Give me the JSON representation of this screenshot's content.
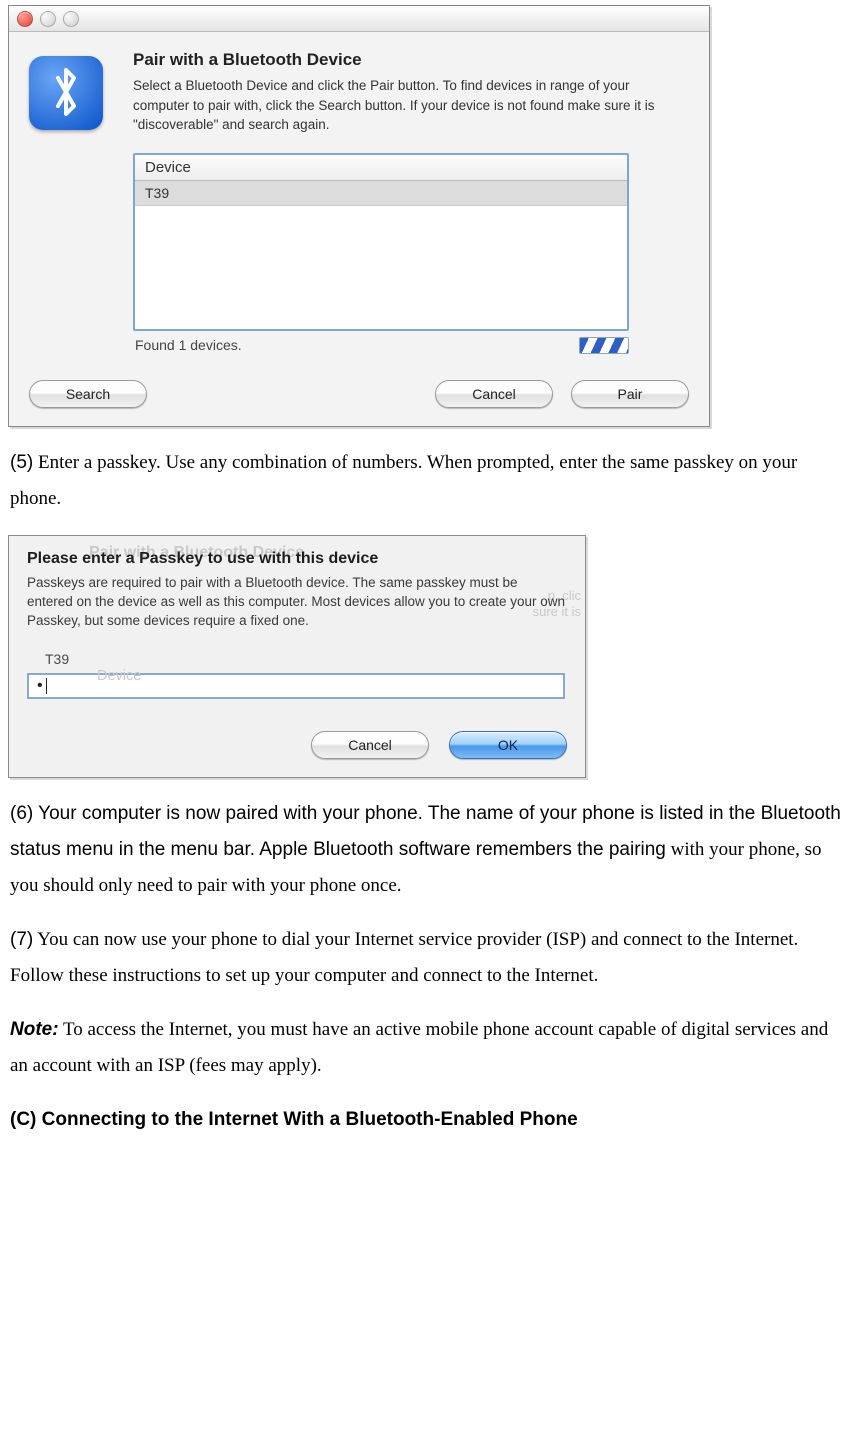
{
  "dialog1": {
    "title": "Pair with a Bluetooth Device",
    "description": "Select a Bluetooth Device and click the Pair button. To find devices in range of your computer to pair with, click the Search button. If your device is not found make sure it is \"discoverable\" and search again.",
    "list_header": "Device",
    "list_items": [
      "T39"
    ],
    "status": "Found 1 devices.",
    "search_button": "Search",
    "cancel_button": "Cancel",
    "pair_button": "Pair"
  },
  "step5": {
    "num": "(5)",
    "text": " Enter a passkey. Use any combination of numbers. When prompted, enter the same passkey on your phone."
  },
  "dialog2": {
    "ghost_title": "Pair with a Bluetooth Device",
    "ghost_right1": "p, clic",
    "ghost_right2": "sure it is",
    "ghost_device": "Device",
    "title": "Please enter a Passkey to use with this device",
    "description": "Passkeys are required to pair with a Bluetooth device.  The same passkey must be entered on the device as well as this computer. Most devices allow you to create your own Passkey, but some devices require a fixed one.",
    "device_label": "T39",
    "input_value": "•",
    "cancel_button": "Cancel",
    "ok_button": "OK"
  },
  "step6": {
    "prefix": "(6) Your computer is now paired with your phone. The name of your phone is listed in the Bluetooth status menu in the menu bar. Apple Bluetooth software remembers the pairing",
    "rest": " with your phone, so you should only need to pair with your phone once."
  },
  "step7": {
    "num": "(7)",
    "text": " You can now use your phone to dial your Internet service provider (ISP) and connect to the Internet. Follow these instructions to set up your computer and connect to the Internet."
  },
  "note": {
    "label": "Note:",
    "text": " To access the Internet, you must have an active mobile phone account capable of digital services and an account with an ISP (fees may apply)."
  },
  "heading_c": "(C) Connecting to the Internet With a Bluetooth-Enabled Phone"
}
